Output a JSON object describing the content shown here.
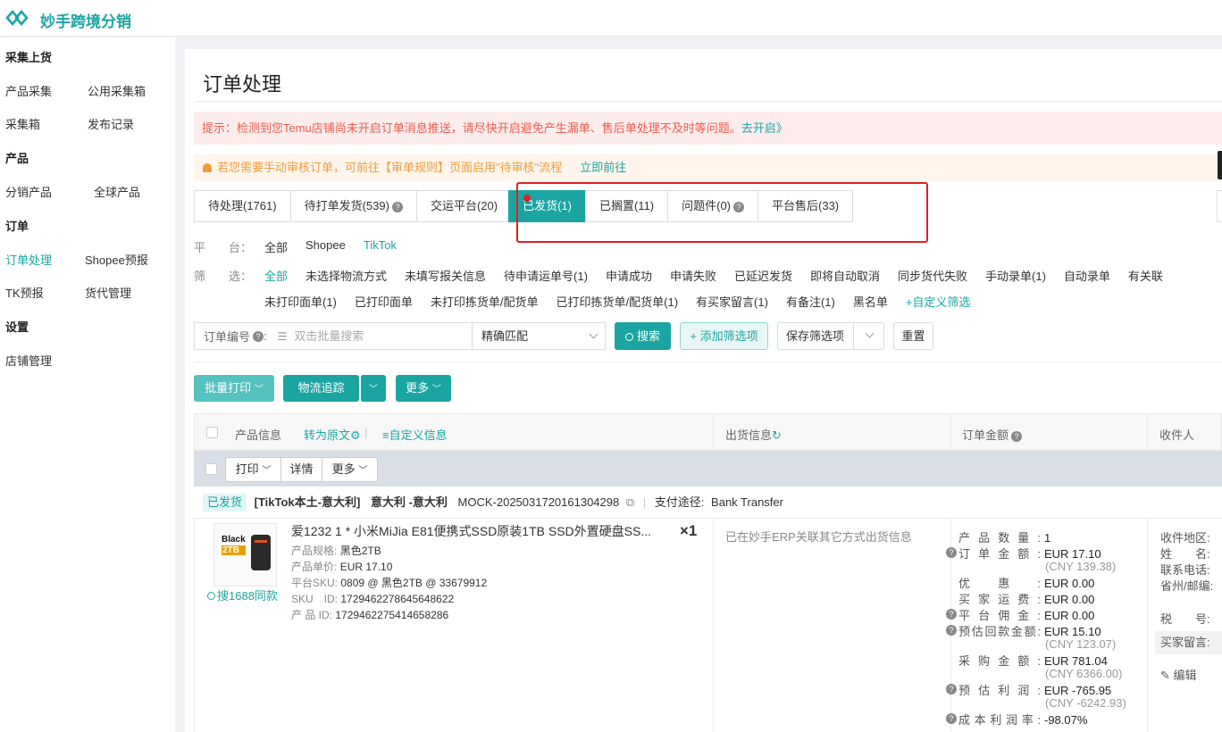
{
  "app": {
    "brand": "妙手跨境分销",
    "logo_icon": "diamond-link-logo"
  },
  "sidebar": {
    "sections": [
      {
        "title": "采集上货",
        "items": [
          "产品采集",
          "公用采集箱",
          "采集箱",
          "发布记录"
        ]
      },
      {
        "title": "产品",
        "items": [
          "分销产品",
          "全球产品"
        ]
      },
      {
        "title": "订单",
        "items": [
          "订单处理",
          "Shopee预报",
          "TK预报",
          "货代管理"
        ]
      },
      {
        "title": "设置",
        "items": [
          "店铺管理"
        ]
      }
    ],
    "active": "订单处理"
  },
  "page": {
    "title": "订单处理"
  },
  "alerts": {
    "red_text": "提示：检测到您Temu店铺尚未开启订单消息推送，请尽快开启避免产生漏单、售后单处理不及时等问题。",
    "red_link": "去开启》",
    "orange_text": "若您需要手动审核订单，可前往【审单规则】页面启用\"待审核\"流程",
    "orange_link": "立即前往"
  },
  "tabs": [
    {
      "label": "待处理(1761)",
      "help": false
    },
    {
      "label": "待打单发货(539)",
      "help": true
    },
    {
      "label": "交运平台(20)",
      "help": false
    },
    {
      "label": "已发货(1)",
      "help": false,
      "active": true
    },
    {
      "label": "已搁置(11)",
      "help": false
    },
    {
      "label": "问题件(0)",
      "help": true
    },
    {
      "label": "平台售后(33)",
      "help": false
    }
  ],
  "filters": {
    "platform_label": "平　　台：",
    "platforms": [
      "全部",
      "Shopee",
      "TikTok"
    ],
    "filter_label": "筛　　选：",
    "row1": [
      "全部",
      "未选择物流方式",
      "未填写报关信息",
      "待申请运单号(1)",
      "申请成功",
      "申请失败",
      "已延迟发货",
      "即将自动取消",
      "同步货代失败",
      "手动录单(1)",
      "自动录单",
      "有关联"
    ],
    "row2": [
      "未打印面单(1)",
      "已打印面单",
      "未打印拣货单/配货单",
      "已打印拣货单/配货单(1)",
      "有买家留言(1)",
      "有备注(1)",
      "黑名单",
      "+自定义筛选"
    ]
  },
  "search": {
    "label": "订单编号",
    "placeholder": "双击批量搜索",
    "match": "精确匹配",
    "search_btn": "搜索",
    "add_filter_btn": "+ 添加筛选项",
    "save_filter_btn": "保存筛选项",
    "reset_btn": "重置"
  },
  "batch": {
    "print": "批量打印",
    "track": "物流追踪",
    "more": "更多"
  },
  "table": {
    "headers": {
      "product": "产品信息",
      "to_original": "转为原文",
      "custom_info": "自定义信息",
      "shipping": "出货信息",
      "amount": "订单金额",
      "receiver": "收件人"
    },
    "subbar": {
      "print": "打印",
      "detail": "详情",
      "more": "更多"
    }
  },
  "order": {
    "status": "已发货",
    "store": "[TikTok本土-意大利]",
    "site": "意大利 -意大利",
    "order_no": "MOCK-2025031720161304298",
    "pay_label": "支付途径:",
    "pay_method": "Bank Transfer",
    "product": {
      "title": "爱1232 1 * 小米MiJia E81便携式SSD原装1TB SSD外置硬盘SS...",
      "qty": "×1",
      "thumb_text1": "Black",
      "thumb_text2": "2TB",
      "spec_label": "产品规格:",
      "spec": "黑色2TB",
      "price_label": "产品单价:",
      "price": "EUR 17.10",
      "sku_platform_label": "平台SKU:",
      "sku_platform": "0809 @ 黑色2TB @ 33679912",
      "sku_label": "SKU　ID:",
      "sku": "1729462278645648622",
      "pid_label": "产 品 ID:",
      "pid": "1729462275414658286",
      "search_1688": "搜1688同款"
    },
    "shipping_info": "已在妙手ERP关联其它方式出货信息",
    "amounts": [
      {
        "k": "产品数量:",
        "v": "1",
        "help": false
      },
      {
        "k": "订单金额:",
        "v": "EUR 17.10",
        "sub": "(CNY 139.38)",
        "help": true
      },
      {
        "k": "优惠:",
        "v": "EUR 0.00",
        "help": false
      },
      {
        "k": "买家运费:",
        "v": "EUR 0.00",
        "help": false
      },
      {
        "k": "平台佣金:",
        "v": "EUR 0.00",
        "help": true
      },
      {
        "k": "预估回款金额:",
        "v": "EUR 15.10",
        "sub": "(CNY 123.07)",
        "help": true
      },
      {
        "k": "采购金额:",
        "v": "EUR 781.04",
        "sub": "(CNY 6366.00)",
        "help": false
      },
      {
        "k": "预估利润:",
        "v": "EUR -765.95",
        "sub": "(CNY -6242.93)",
        "help": true
      },
      {
        "k": "成本利润率:",
        "v": "-98.07%",
        "help": true
      }
    ],
    "receiver": {
      "region": "收件地区:",
      "name": "姓　　名:",
      "phone": "联系电话:",
      "zip": "省州/邮编:",
      "tax": "税　　号:",
      "note": "买家留言:",
      "edit": "编辑"
    }
  },
  "colors": {
    "accent": "#1aa5a3",
    "alert_red": "#f05b4b",
    "alert_orange": "#f29b38",
    "highlight_box": "#e02020"
  }
}
